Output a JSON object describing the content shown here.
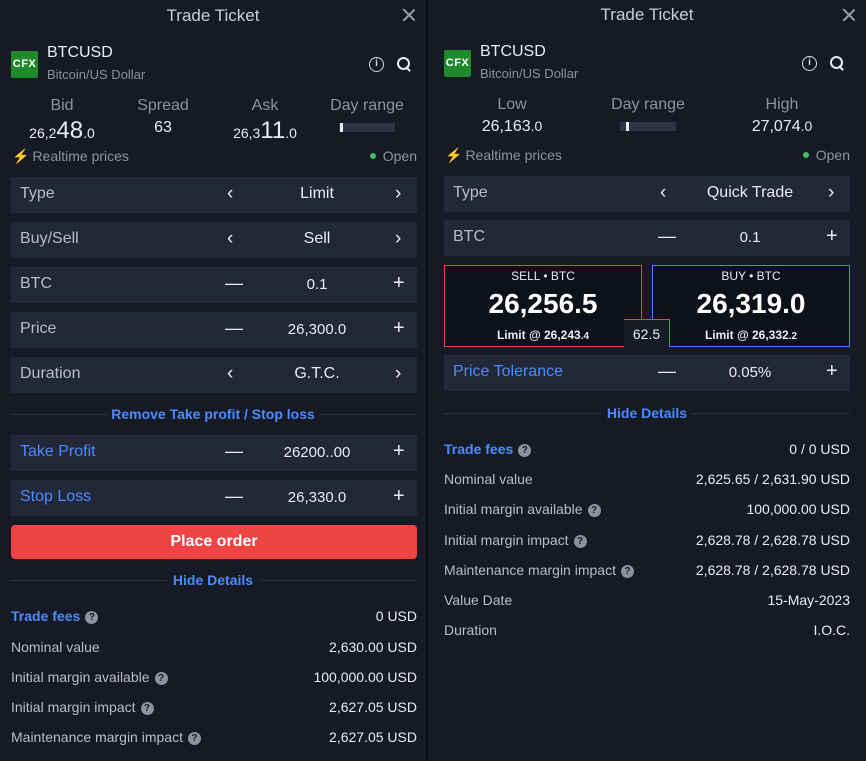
{
  "left": {
    "title": "Trade Ticket",
    "instrument": {
      "logo": "CFX",
      "symbol": "BTCUSD",
      "description": "Bitcoin/US Dollar"
    },
    "quotes": {
      "bid_label": "Bid",
      "bid_prefix": "26,2",
      "bid_main": "48",
      "bid_suffix": ".0",
      "spread_label": "Spread",
      "spread_value": "63",
      "ask_label": "Ask",
      "ask_prefix": "26,3",
      "ask_main": "11",
      "ask_suffix": ".0",
      "dayrange_label": "Day range"
    },
    "status": {
      "realtime": "Realtime prices",
      "market": "Open"
    },
    "fields": {
      "type_label": "Type",
      "type_value": "Limit",
      "side_label": "Buy/Sell",
      "side_value": "Sell",
      "qty_label": "BTC",
      "qty_value": "0.1",
      "price_label": "Price",
      "price_value": "26,300.0",
      "duration_label": "Duration",
      "duration_value": "G.T.C."
    },
    "remove_tp_sl": "Remove Take profit / Stop loss",
    "take_profit": {
      "label": "Take Profit",
      "value": "26200..00"
    },
    "stop_loss": {
      "label": "Stop Loss",
      "value": "26,330.0"
    },
    "place_order": "Place order",
    "hide_details": "Hide Details",
    "details": [
      {
        "label": "Trade fees",
        "value": "0 USD"
      },
      {
        "label": "Nominal value",
        "value": "2,630.00 USD"
      },
      {
        "label": "Initial margin available",
        "value": "100,000.00 USD"
      },
      {
        "label": "Initial margin impact",
        "value": "2,627.05 USD"
      },
      {
        "label": "Maintenance margin impact",
        "value": "2,627.05 USD"
      }
    ]
  },
  "right": {
    "title": "Trade Ticket",
    "instrument": {
      "logo": "CFX",
      "symbol": "BTCUSD",
      "description": "Bitcoin/US Dollar"
    },
    "quotes": {
      "low_label": "Low",
      "low_main": "26,163",
      "low_suffix": ".0",
      "dayrange_label": "Day range",
      "high_label": "High",
      "high_main": "27,074",
      "high_suffix": ".0"
    },
    "status": {
      "realtime": "Realtime prices",
      "market": "Open"
    },
    "fields": {
      "type_label": "Type",
      "type_value": "Quick Trade",
      "qty_label": "BTC",
      "qty_value": "0.1"
    },
    "sell": {
      "header": "SELL • BTC",
      "price": "26,256.5",
      "limit_main": "Limit @ 26,243",
      "limit_suffix": ".4"
    },
    "buy": {
      "header": "BUY • BTC",
      "price": "26,319.0",
      "limit_main": "Limit @ 26,332",
      "limit_suffix": ".2"
    },
    "spread": "62.5",
    "tolerance": {
      "label": "Price Tolerance",
      "value": "0.05%"
    },
    "hide_details": "Hide Details",
    "details": [
      {
        "label": "Trade fees",
        "value": "0 / 0 USD"
      },
      {
        "label": "Nominal value",
        "value": "2,625.65 / 2,631.90 USD"
      },
      {
        "label": "Initial margin available",
        "value": "100,000.00 USD"
      },
      {
        "label": "Initial margin impact",
        "value": "2,628.78 / 2,628.78 USD"
      },
      {
        "label": "Maintenance margin impact",
        "value": "2,628.78 / 2,628.78 USD"
      },
      {
        "label": "Value Date",
        "value": "15-May-2023"
      },
      {
        "label": "Duration",
        "value": "I.O.C."
      }
    ]
  },
  "icons": {
    "close": "close-icon",
    "info": "info-icon",
    "search": "search-icon",
    "realtime": "lightning-icon",
    "open": "status-dot-icon",
    "help": "question-icon"
  },
  "colors": {
    "panel": "#161a24",
    "row": "#222838",
    "accent_blue": "#4a8cff",
    "sell_red": "#ef4444",
    "live_green": "#3cc25b",
    "cfx_green": "#1f8a2c"
  }
}
